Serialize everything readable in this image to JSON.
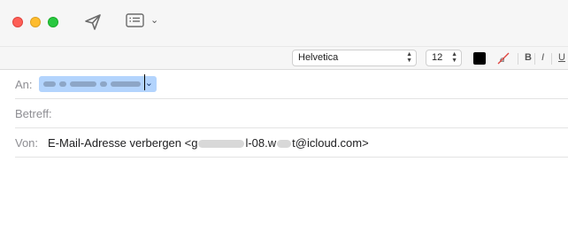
{
  "toolbar": {
    "send_icon": "paper-plane-icon",
    "format_icon": "list-icon",
    "format_chevron": "⌄"
  },
  "formatbar": {
    "font": "Helvetica",
    "size": "12",
    "text_color": "#000000",
    "bold": "B",
    "italic": "I",
    "underline": "U"
  },
  "fields": {
    "to_label": "An:",
    "subject_label": "Betreff:",
    "from_label": "Von:",
    "from_prefix": "E-Mail-Adresse verbergen <g",
    "from_middle": "l-08.w",
    "from_suffix": "t@icloud.com>"
  },
  "colors": {
    "close": "#fe5f57",
    "minimize": "#febc2e",
    "zoom": "#28c840",
    "selection": "#b3d4fd"
  }
}
